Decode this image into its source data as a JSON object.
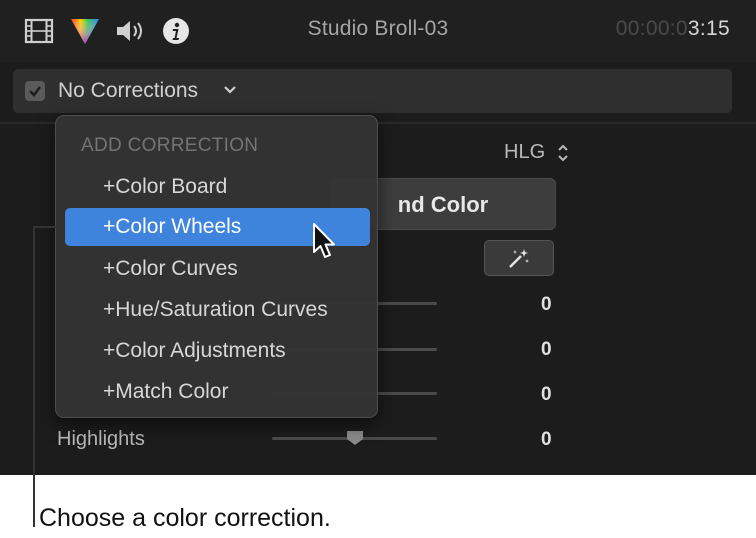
{
  "toolbar": {
    "icons": [
      "film-icon",
      "color-triangle-icon",
      "speaker-icon",
      "info-icon"
    ],
    "clip_title": "Studio Broll-03",
    "timecode_dim": "00:00:0",
    "timecode_lit": "3:15"
  },
  "correction_bar": {
    "checked": true,
    "label": "No Corrections"
  },
  "inspector": {
    "color_space": "HLG",
    "balance_label": "nd Color",
    "params": [
      {
        "label": "",
        "value": "0"
      },
      {
        "label": "",
        "value": "0"
      },
      {
        "label": "",
        "value": "0"
      },
      {
        "label": "Highlights",
        "value": "0"
      }
    ]
  },
  "menu": {
    "header": "ADD CORRECTION",
    "items": [
      {
        "label": "+Color Board",
        "active": false
      },
      {
        "label": "+Color Wheels",
        "active": true
      },
      {
        "label": "+Color Curves",
        "active": false
      },
      {
        "label": "+Hue/Saturation Curves",
        "active": false
      },
      {
        "label": "+Color Adjustments",
        "active": false
      },
      {
        "label": "+Match Color",
        "active": false
      }
    ]
  },
  "callout": {
    "text": "Choose a color correction."
  },
  "colors": {
    "panel_bg": "#1c1c1c",
    "menu_bg": "#343434",
    "highlight": "#3f84dc"
  }
}
